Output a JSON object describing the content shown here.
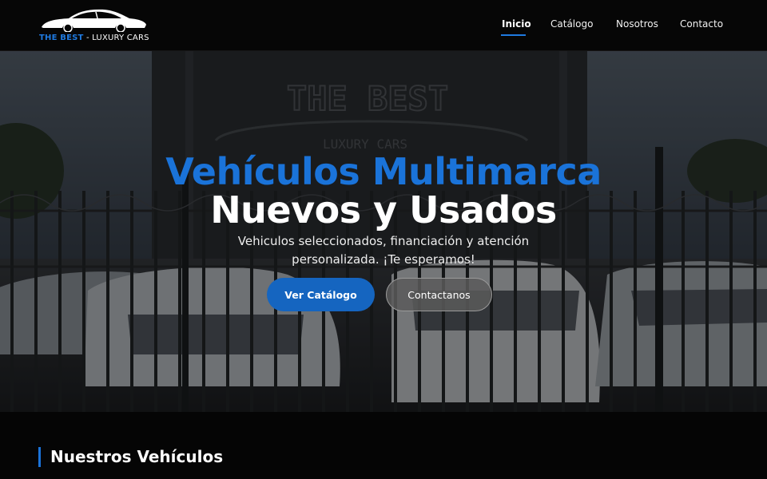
{
  "brand": {
    "part1": "THE BEST",
    "part2": " - LUXURY CARS",
    "logo_icon": "sports-car-silhouette-icon"
  },
  "nav": {
    "items": [
      {
        "label": "Inicio",
        "active": true
      },
      {
        "label": "Catálogo",
        "active": false
      },
      {
        "label": "Nosotros",
        "active": false
      },
      {
        "label": "Contacto",
        "active": false
      }
    ]
  },
  "hero": {
    "title_line1": "Vehículos Multimarca",
    "title_line2": "Nuevos y Usados",
    "subtitle": "Vehiculos seleccionados, financiación y atención personalizada. ¡Te esperamos!",
    "background": "car-dealership-lot-photo",
    "sign_line1": "THE BEST",
    "sign_line2": "LUXURY CARS",
    "primary_button": "Ver Catálogo",
    "secondary_button": "Contactanos"
  },
  "section": {
    "title": "Nuestros Vehículos"
  },
  "colors": {
    "accent": "#1a73d9",
    "button_primary": "#1565c0",
    "background": "#050505"
  }
}
